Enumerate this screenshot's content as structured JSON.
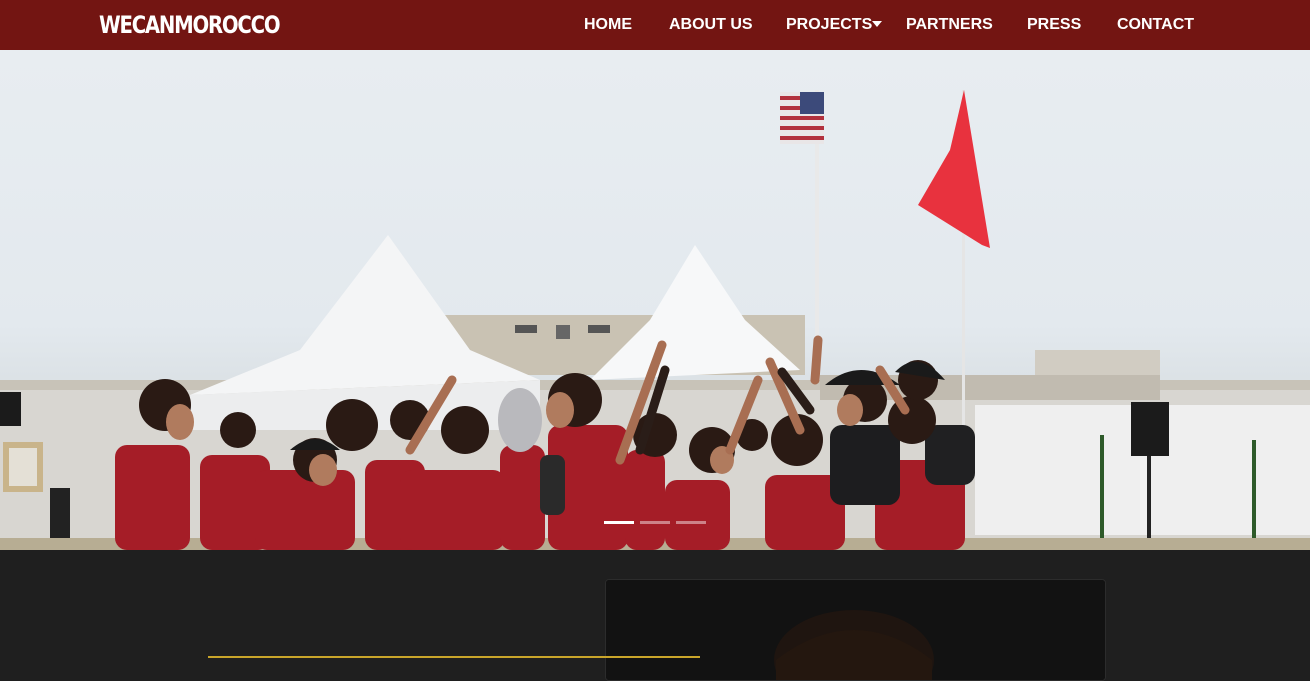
{
  "brand": {
    "logo_text": "WECANMOROCCO"
  },
  "nav": {
    "items": [
      {
        "label": "HOME"
      },
      {
        "label": "ABOUT US"
      },
      {
        "label": "PROJECTS",
        "has_dropdown": true,
        "dropdown_icon": "caret-down-icon"
      },
      {
        "label": "PARTNERS"
      },
      {
        "label": "PRESS"
      },
      {
        "label": "CONTACT"
      }
    ]
  },
  "hero": {
    "slide_count": 3,
    "active_slide": 1
  },
  "colors": {
    "navbar": "#731512",
    "nav_text": "#ffffff",
    "page_bg": "#1f1f1f",
    "accent_line": "#c9a52a",
    "jersey_red": "#a51d27"
  }
}
